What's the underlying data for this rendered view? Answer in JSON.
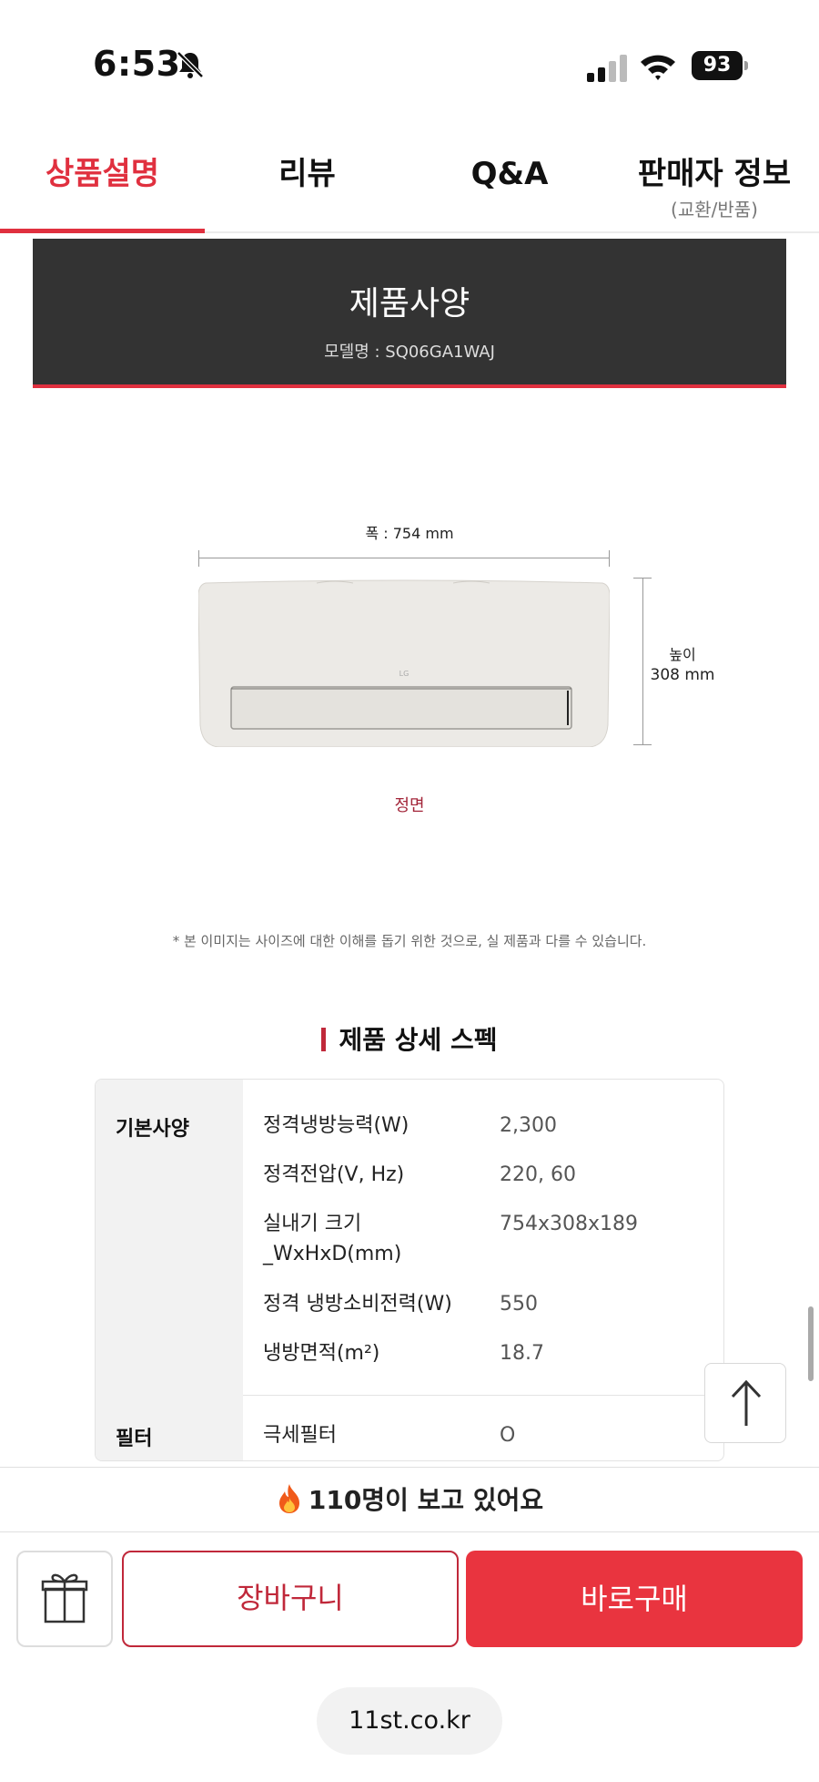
{
  "status_bar": {
    "time": "6:53",
    "battery": "93",
    "icons": [
      "bell-slash-icon",
      "cellular-signal-icon",
      "wifi-icon",
      "battery-icon"
    ]
  },
  "tabs": [
    {
      "label": "상품설명",
      "sub": "",
      "active": true
    },
    {
      "label": "리뷰",
      "sub": ""
    },
    {
      "label": "Q&A",
      "sub": ""
    },
    {
      "label": "판매자 정보",
      "sub": "(교환/반품)"
    }
  ],
  "banner": {
    "title": "제품사양",
    "model": "모델명 : SQ06GA1WAJ"
  },
  "diagram": {
    "width_label": "폭 : 754 mm",
    "height_label": "높이",
    "height_value": "308 mm",
    "brand_mark": "LG",
    "view_label": "정면"
  },
  "disclaimer": "* 본 이미지는 사이즈에 대한 이해를 돕기 위한 것으로, 실 제품과 다를 수 있습니다.",
  "spec": {
    "heading": "제품 상세 스펙",
    "groups": [
      {
        "category": "기본사양",
        "rows": [
          {
            "key": "정격냉방능력(W)",
            "value": "2,300"
          },
          {
            "key": "정격전압(V, Hz)",
            "value": "220, 60"
          },
          {
            "key": "실내기 크기 _WxHxD(mm)",
            "value": "754x308x189"
          },
          {
            "key": "정격 냉방소비전력(W)",
            "value": "550"
          },
          {
            "key": "냉방면적(m²)",
            "value": "18.7"
          }
        ]
      },
      {
        "category": "필터",
        "rows": [
          {
            "key": "극세필터",
            "value": "O"
          }
        ]
      }
    ]
  },
  "viewers": {
    "text": "110명이 보고 있어요",
    "icon": "fire-icon"
  },
  "actions": {
    "gift_icon": "gift-icon",
    "cart_label": "장바구니",
    "buy_label": "바로구매"
  },
  "browser": {
    "url": "11st.co.kr"
  },
  "colors": {
    "accent": "#e0303f",
    "banner_bg": "#333333",
    "buy_bg": "#e9343f"
  }
}
